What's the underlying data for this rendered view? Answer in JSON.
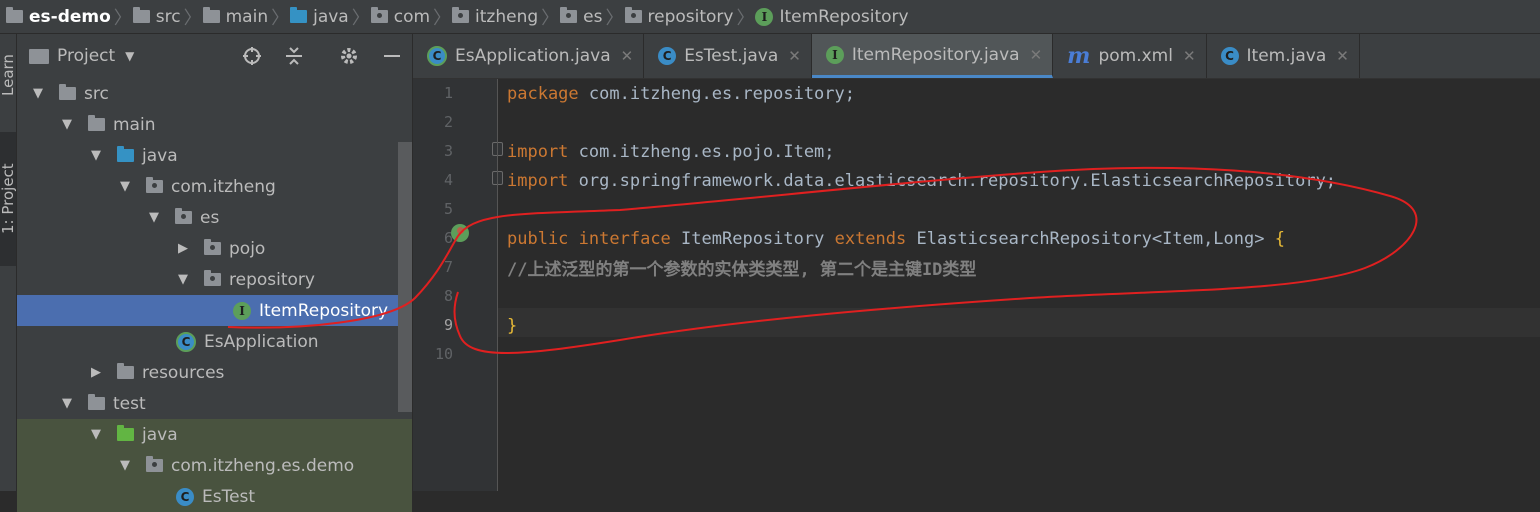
{
  "breadcrumb": {
    "project": "es-demo",
    "items": [
      "src",
      "main",
      "java",
      "com",
      "itzheng",
      "es",
      "repository",
      "ItemRepository"
    ]
  },
  "sidebar": {
    "learn_tab": "Learn",
    "project_tab": "1: Project"
  },
  "project_panel": {
    "title": "Project",
    "tree": {
      "src": "src",
      "main": "main",
      "java": "java",
      "com_itzheng": "com.itzheng",
      "es": "es",
      "pojo": "pojo",
      "repository": "repository",
      "item_repository": "ItemRepository",
      "es_application": "EsApplication",
      "resources": "resources",
      "test": "test",
      "test_java": "java",
      "test_pkg": "com.itzheng.es.demo",
      "es_test": "EsTest"
    }
  },
  "tabs": [
    {
      "label": "EsApplication.java",
      "icon": "spring-class-icon"
    },
    {
      "label": "EsTest.java",
      "icon": "class-icon"
    },
    {
      "label": "ItemRepository.java",
      "icon": "interface-icon"
    },
    {
      "label": "pom.xml",
      "icon": "maven-icon"
    },
    {
      "label": "Item.java",
      "icon": "class-icon"
    }
  ],
  "editor": {
    "line_numbers": [
      "1",
      "2",
      "3",
      "4",
      "5",
      "6",
      "7",
      "8",
      "9",
      "10"
    ],
    "line1": {
      "kw": "package",
      "rest": " com.itzheng.es.repository;"
    },
    "line3": {
      "kw": "import",
      "rest": " com.itzheng.es.pojo.Item;"
    },
    "line4": {
      "kw": "import",
      "rest": " org.springframework.data.elasticsearch.repository.ElasticsearchRepository;"
    },
    "line6": {
      "kw1": "public",
      "kw2": "interface",
      "name": "ItemRepository",
      "kw3": "extends",
      "parent": "ElasticsearchRepository<Item,Long>",
      "brace": "{"
    },
    "line7": "//上述泛型的第一个参数的实体类类型, 第二个是主键ID类型",
    "line9": "}"
  },
  "colors": {
    "keyword": "#cc7832",
    "plain": "#a9b7c6",
    "comment": "#808080",
    "selection": "#4b6eaf",
    "annotation": "#e02020"
  }
}
